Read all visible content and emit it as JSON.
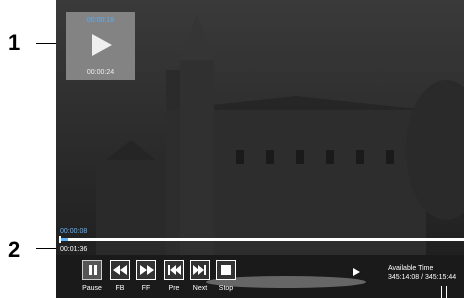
{
  "callouts": {
    "one": "1",
    "two": "2"
  },
  "thumbnail": {
    "top_time": "00:00:18",
    "bottom_time": "00:00:24"
  },
  "progress": {
    "top_time": "00:00:08",
    "current_time": "00:01:36",
    "fraction": 0.02
  },
  "controls": [
    {
      "id": "pause",
      "label": "Pause"
    },
    {
      "id": "fb",
      "label": "FB"
    },
    {
      "id": "ff",
      "label": "FF"
    },
    {
      "id": "pre",
      "label": "Pre"
    },
    {
      "id": "next",
      "label": "Next"
    },
    {
      "id": "stop",
      "label": "Stop"
    }
  ],
  "available": {
    "title": "Available Time",
    "value": "345:14:08 / 345:15:44"
  },
  "colors": {
    "accent": "#5fb6ff",
    "background": "#222222"
  }
}
